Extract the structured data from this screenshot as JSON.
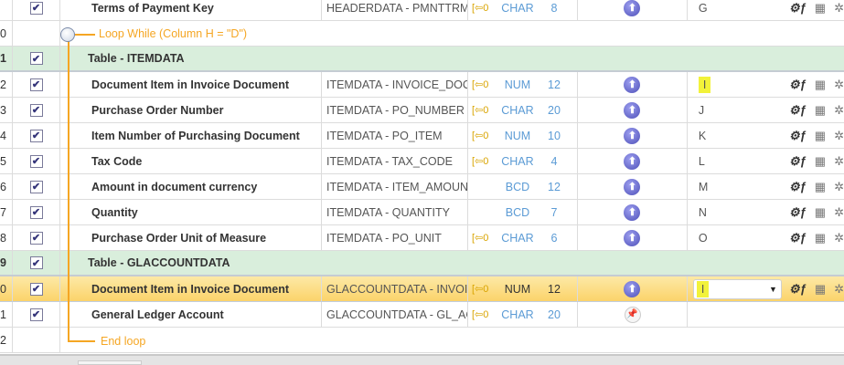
{
  "rows": [
    {
      "num": "",
      "checked": true,
      "name": "Terms of Payment Key",
      "field": "HEADERDATA - PMNTTRMS",
      "arrow": "0",
      "type": "CHAR",
      "len": "8",
      "icon": "up",
      "column": "G"
    },
    {
      "num": "0",
      "loop": true
    },
    {
      "num": "1",
      "table": true,
      "checked": true,
      "name": "Table - ITEMDATA"
    },
    {
      "num": "2",
      "checked": true,
      "name": "Document Item in Invoice Document",
      "field": "ITEMDATA - INVOICE_DOC_...",
      "arrow": "0",
      "type": "NUM",
      "len": "12",
      "icon": "up",
      "column": "I",
      "highlight": true
    },
    {
      "num": "3",
      "checked": true,
      "name": "Purchase Order Number",
      "field": "ITEMDATA - PO_NUMBER",
      "arrow": "0",
      "type": "CHAR",
      "len": "20",
      "icon": "up",
      "column": "J"
    },
    {
      "num": "4",
      "checked": true,
      "name": "Item Number of Purchasing Document",
      "field": "ITEMDATA - PO_ITEM",
      "arrow": "0",
      "type": "NUM",
      "len": "10",
      "icon": "up",
      "column": "K"
    },
    {
      "num": "5",
      "checked": true,
      "name": "Tax Code",
      "field": "ITEMDATA - TAX_CODE",
      "arrow": "0",
      "type": "CHAR",
      "len": "4",
      "icon": "up",
      "column": "L"
    },
    {
      "num": "6",
      "checked": true,
      "name": "Amount in document currency",
      "field": "ITEMDATA - ITEM_AMOUNT",
      "arrow": "",
      "type": "BCD",
      "len": "12",
      "icon": "up",
      "column": "M"
    },
    {
      "num": "7",
      "checked": true,
      "name": "Quantity",
      "field": "ITEMDATA - QUANTITY",
      "arrow": "",
      "type": "BCD",
      "len": "7",
      "icon": "up",
      "column": "N"
    },
    {
      "num": "8",
      "checked": true,
      "name": "Purchase Order Unit of Measure",
      "field": "ITEMDATA - PO_UNIT",
      "arrow": "0",
      "type": "CHAR",
      "len": "6",
      "icon": "up",
      "column": "O"
    },
    {
      "num": "9",
      "table": true,
      "checked": true,
      "name": "Table - GLACCOUNTDATA"
    },
    {
      "num": "0",
      "checked": true,
      "selected": true,
      "name": "Document Item in Invoice Document",
      "field": "GLACCOUNTDATA - INVOI...",
      "arrow": "0",
      "type": "NUM",
      "len": "12",
      "icon": "up",
      "column": "I",
      "highlight": true,
      "dropdown": true
    },
    {
      "num": "1",
      "checked": true,
      "name": "General Ledger Account",
      "field": "GLACCOUNTDATA - GL_AC...",
      "arrow": "0",
      "type": "CHAR",
      "len": "20",
      "icon": "pin",
      "column": ""
    },
    {
      "num": "2",
      "endloop": true
    }
  ],
  "loop": {
    "start_label": "Loop While (Column H = \"D\")",
    "end_label": "End loop"
  },
  "colors": {
    "accent": "#f5a623",
    "table_row": "#d9eedc",
    "highlight": "#f2f23a"
  }
}
